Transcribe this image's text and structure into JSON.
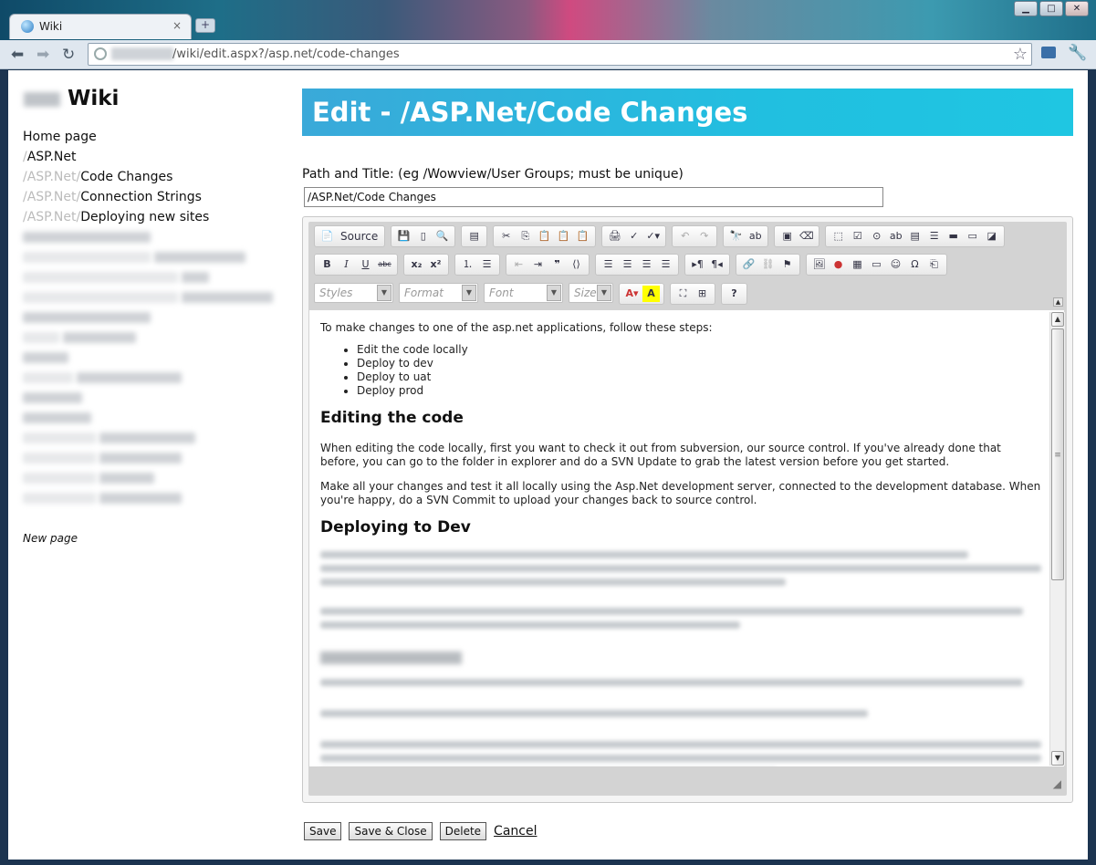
{
  "browser": {
    "tab_title": "Wiki",
    "tab_close": "×",
    "new_tab": "+",
    "url": "/wiki/edit.aspx?/asp.net/code-changes",
    "window_buttons": [
      "▁",
      "□",
      "✕"
    ],
    "icons": [
      "back-icon",
      "forward-icon",
      "reload-icon",
      "star-icon",
      "mail-icon",
      "wrench-icon"
    ]
  },
  "sidebar": {
    "brand": "Wiki",
    "items": [
      {
        "prefix": "",
        "label": "Home page"
      },
      {
        "prefix": "/",
        "label": "ASP.Net"
      },
      {
        "prefix": "/ASP.Net/",
        "label": "Code Changes"
      },
      {
        "prefix": "/ASP.Net/",
        "label": "Connection Strings"
      },
      {
        "prefix": "/ASP.Net/",
        "label": "Deploying new sites"
      }
    ],
    "new_page": "New page"
  },
  "main": {
    "title": "Edit - /ASP.Net/Code Changes",
    "path_label": "Path and Title: (eg /Wowview/User Groups; must be unique)",
    "path_value": "/ASP.Net/Code Changes"
  },
  "editor": {
    "source_label": "Source",
    "combos": {
      "styles": "Styles",
      "format": "Format",
      "font": "Font",
      "size": "Size"
    },
    "content": {
      "intro": "To make changes to one of the asp.net applications, follow these steps:",
      "steps": [
        "Edit the code locally",
        "Deploy to dev",
        "Deploy to uat",
        "Deploy prod"
      ],
      "h_editing": "Editing the code",
      "p_editing_1": "When editing the code locally, first you want to check it out from subversion, our source control. If you've already done that before, you can go to the folder in explorer and do a SVN Update to grab the latest version before you get started.",
      "p_editing_2": "Make all your changes and test it all locally using the Asp.Net development server, connected to the development database. When you're happy, do a SVN Commit to upload your changes back to source control.",
      "h_dev": "Deploying to Dev"
    }
  },
  "actions": {
    "save": "Save",
    "save_close": "Save & Close",
    "delete": "Delete",
    "cancel": "Cancel"
  }
}
